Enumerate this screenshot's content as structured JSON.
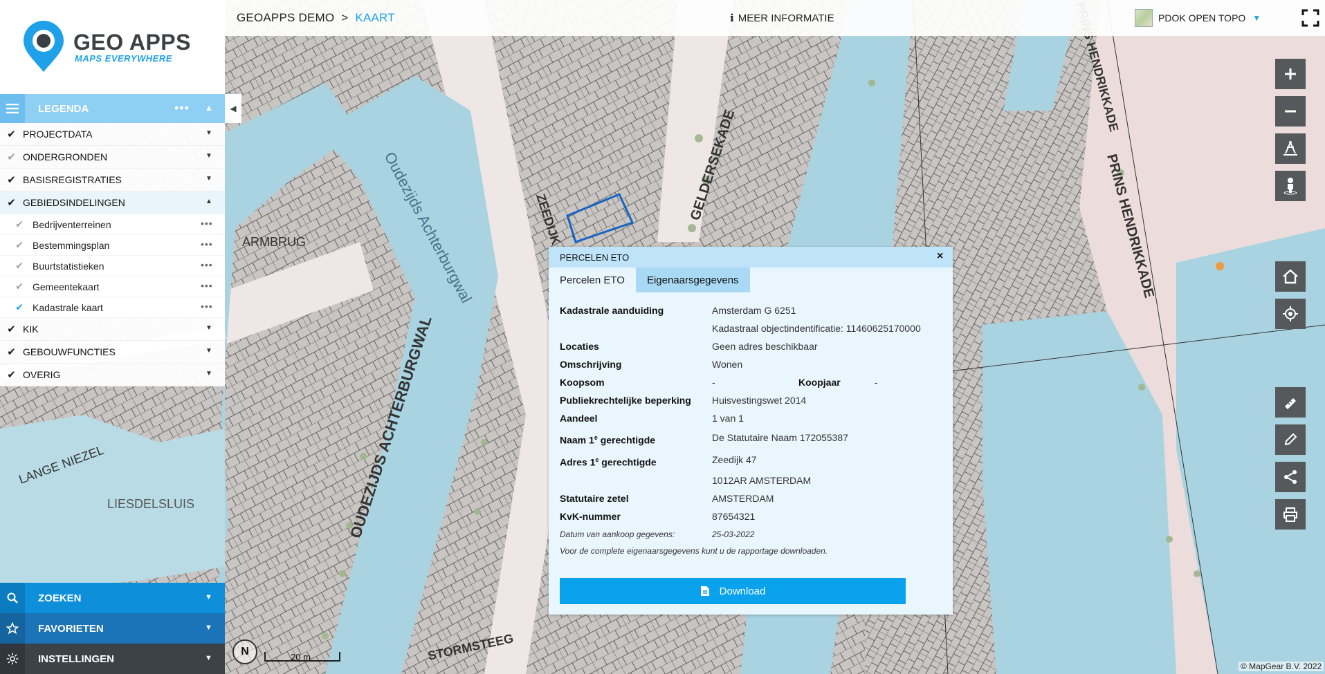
{
  "app": {
    "brand": "GEO APPS",
    "tagline": "MAPS EVERYWHERE"
  },
  "topbar": {
    "breadcrumb": [
      "GEOAPPS DEMO",
      "KAART"
    ],
    "separator": ">",
    "more_info": "MEER INFORMATIE",
    "basemap": "PDOK OPEN TOPO"
  },
  "legend": {
    "title": "LEGENDA",
    "groups": [
      {
        "label": "PROJECTDATA"
      },
      {
        "label": "ONDERGRONDEN"
      },
      {
        "label": "BASISREGISTRATIES"
      },
      {
        "label": "GEBIEDSINDELINGEN"
      },
      {
        "label": "KIK"
      },
      {
        "label": "GEBOUWFUNCTIES"
      },
      {
        "label": "OVERIG"
      }
    ],
    "sublayers": [
      {
        "label": "Bedrijventerreinen"
      },
      {
        "label": "Bestemmingsplan"
      },
      {
        "label": "Buurtstatistieken"
      },
      {
        "label": "Gemeentekaart"
      },
      {
        "label": "Kadastrale kaart"
      }
    ]
  },
  "bottom_nav": {
    "search": "ZOEKEN",
    "favorites": "FAVORIETEN",
    "settings": "INSTELLINGEN"
  },
  "popup": {
    "title": "PERCELEN ETO",
    "close": "×",
    "tabs": [
      "Percelen ETO",
      "Eigenaarsgegevens"
    ],
    "fields": {
      "kadastrale_label": "Kadastrale aanduiding",
      "kadastrale_value": "Amsterdam G 6251",
      "object_id": "Kadastraal objectindentificatie: 11460625170000",
      "locaties_label": "Locaties",
      "locaties_value": "Geen adres beschikbaar",
      "omschrijving_label": "Omschrijving",
      "omschrijving_value": "Wonen",
      "koopsom_label": "Koopsom",
      "koopsom_value": "-",
      "koopjaar_label": "Koopjaar",
      "koopjaar_value": "-",
      "publiek_label": "Publiekrechtelijke beperking",
      "publiek_value": "Huisvestingswet 2014",
      "aandeel_label": "Aandeel",
      "aandeel_value": "1 van 1",
      "naam_label": "Naam 1",
      "naam_sup": "e",
      "naam_label_tail": " gerechtigde",
      "naam_value": "De Statutaire Naam 172055387",
      "adres_label": "Adres 1",
      "adres_sup": "e",
      "adres_label_tail": " gerechtigde",
      "adres_value_1": "Zeedijk 47",
      "adres_value_2": "1012AR AMSTERDAM",
      "zetel_label": "Statutaire zetel",
      "zetel_value": "AMSTERDAM",
      "kvk_label": "KvK-nummer",
      "kvk_value": "87654321",
      "datum_label": "Datum van aankoop gegevens:",
      "datum_value": "25-03-2022",
      "footnote": "Voor de complete eigenaarsgegevens kunt u de rapportage downloaden."
    },
    "download": "Download"
  },
  "map": {
    "street_labels": [
      "Oudezijds Achterburgwal",
      "OUDEZIJDS ACHTERBURGWAL",
      "GELDERSEKADE",
      "PRINS HENDRIKKADE",
      "ARMBRUG",
      "LANGE NIEZEL",
      "LIESDELSLUIS",
      "ZEEDIJK",
      "STORMSTEEG"
    ],
    "scale": "20 m",
    "compass": "N",
    "copyright": "© MapGear B.V. 2022"
  },
  "colors": {
    "accent": "#1ea1e8",
    "water": "#a9d3e0",
    "parcel": "#c9c6c3",
    "road": "#f3eeee"
  }
}
